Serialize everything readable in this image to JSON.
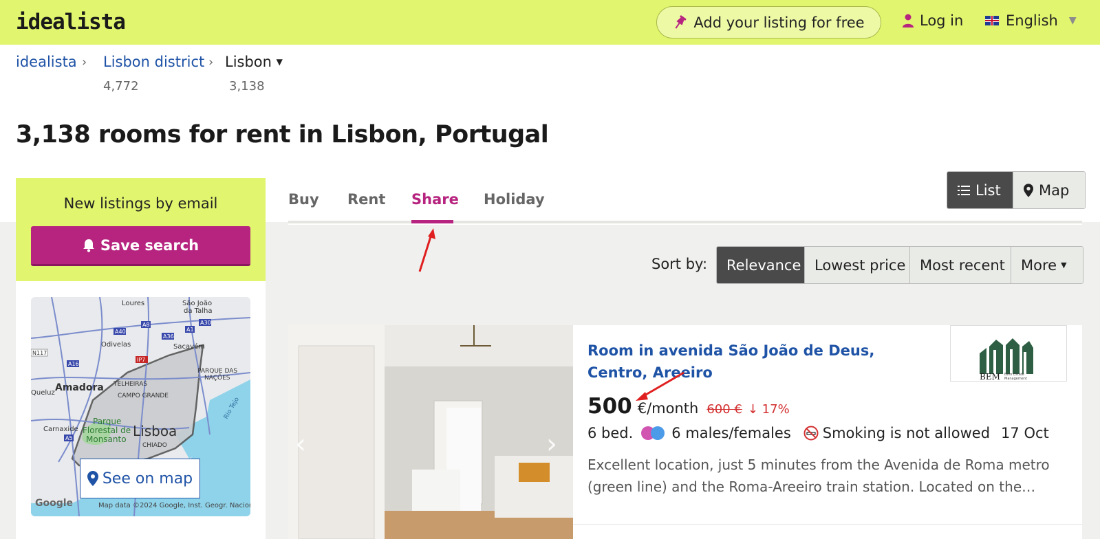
{
  "header": {
    "logo": "idealista",
    "add_listing": "Add your listing for free",
    "login": "Log in",
    "language": "English"
  },
  "breadcrumb": {
    "items": [
      {
        "label": "idealista",
        "count": ""
      },
      {
        "label": "Lisbon district",
        "count": "4,772"
      },
      {
        "label": "Lisbon",
        "count": "3,138"
      }
    ]
  },
  "page_title": "3,138 rooms for rent in Lisbon, Portugal",
  "sidebar": {
    "alert_title": "New listings by email",
    "save_search": "Save search",
    "see_on_map": "See on map",
    "map_labels": {
      "google": "Google",
      "map_data": "Map data ©2024 Google, Inst. Geogr. Nacional",
      "places": [
        "Loures",
        "São João da Talha",
        "Odivelas",
        "Sacavém",
        "Amadora",
        "TELHEIRAS",
        "PARQUE DAS NAÇÕES",
        "CAMPO GRANDE",
        "Queluz",
        "Parque Florestal de Monsanto",
        "Carnaxide",
        "Lisboa",
        "CHIADO",
        "Rio Tejo"
      ],
      "roads": [
        "A40",
        "A8",
        "A1",
        "A36",
        "A30",
        "N117",
        "A16",
        "IP7",
        "A5"
      ]
    }
  },
  "tabs": {
    "items": [
      "Buy",
      "Rent",
      "Share",
      "Holiday"
    ],
    "active": "Share"
  },
  "view_toggle": {
    "list": "List",
    "map": "Map"
  },
  "sort": {
    "label": "Sort by:",
    "options": [
      "Relevance",
      "Lowest price",
      "Most recent",
      "More"
    ]
  },
  "listing": {
    "title": "Room in avenida São João de Deus, Centro, Areeiro",
    "price": "500",
    "price_unit": "€/month",
    "old_price": "600 €",
    "price_drop": "17%",
    "beds": "6 bed.",
    "occupants": "6 males/females",
    "smoking": "Smoking is not allowed",
    "date": "17 Oct",
    "description": "Excellent location, just 5 minutes from the Avenida de Roma metro (green line) and the Roma-Areeiro train station. Located on the…",
    "agency_logo_text": "BEM",
    "agency_logo_sub": "Bem Estate Management"
  },
  "colors": {
    "brand_green": "#e1f56e",
    "brand_magenta": "#b6247f",
    "link_blue": "#1f53a6",
    "price_drop_red": "#d32f2f"
  }
}
